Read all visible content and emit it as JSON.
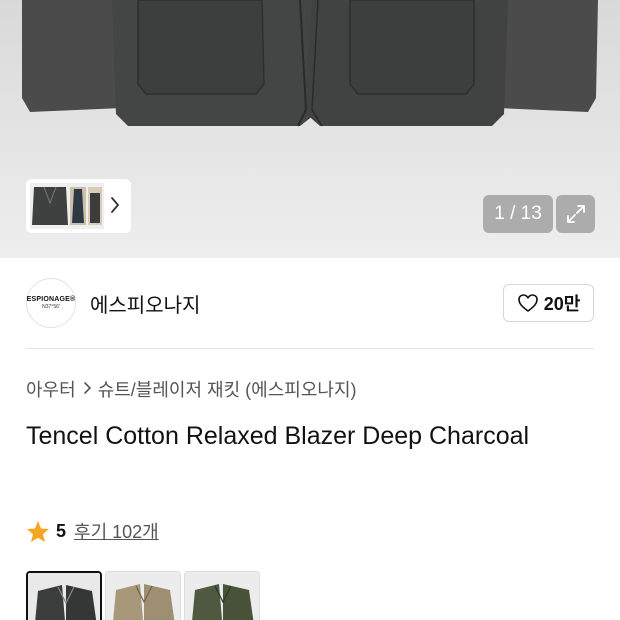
{
  "gallery": {
    "counter": "1 / 13",
    "thumb_nav_icon": "chevron-right-icon",
    "expand_icon": "expand-icon"
  },
  "brand": {
    "logo_line1": "ESPIONAGE®",
    "logo_line2": "N37°56'",
    "name": "에스피오나지",
    "like_count": "20만",
    "like_icon": "heart-icon"
  },
  "breadcrumb": {
    "category": "아우터",
    "subcategory": "슈트/블레이저 재킷 (에스피오나지)"
  },
  "product": {
    "title": "Tencel Cotton Relaxed Blazer Deep Charcoal",
    "rating": "5",
    "reviews": "후기 102개"
  },
  "swatches": [
    {
      "name": "deep-charcoal",
      "color": "#3b3d3c"
    },
    {
      "name": "beige",
      "color": "#a8987a"
    },
    {
      "name": "olive",
      "color": "#4f5940"
    }
  ],
  "colors": {
    "accent_star": "#f5a623",
    "hero_bg": "#e7e7e7"
  }
}
